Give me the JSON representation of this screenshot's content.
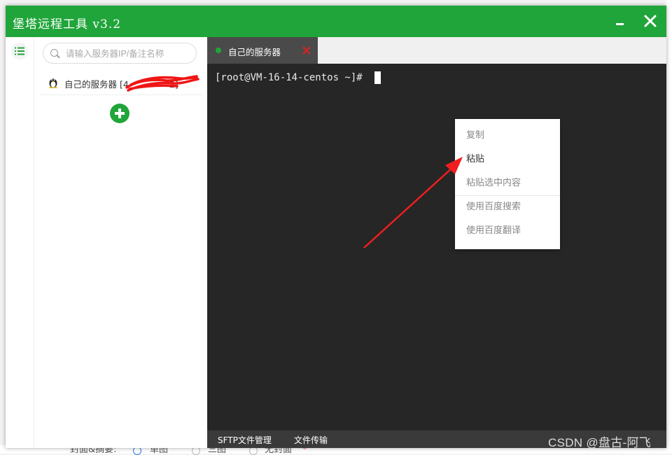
{
  "window": {
    "title": "堡塔远程工具 v3.2",
    "accent_color": "#20a53a"
  },
  "sidebar": {
    "search_placeholder": "请输入服务器IP/备注名称",
    "servers": [
      {
        "label": "自己的服务器 [4",
        "suffix": "2]",
        "os_icon": "linux-tux-icon"
      }
    ],
    "add_icon": "plus-icon"
  },
  "terminal": {
    "tabs": [
      {
        "label": "自己的服务器",
        "status_color": "#20a53a"
      }
    ],
    "prompt": "[root@VM-16-14-centos ~]#"
  },
  "bottom_bar": {
    "sftp_label": "SFTP文件管理",
    "transfer_label": "文件传输"
  },
  "context_menu": {
    "items": [
      {
        "label": "复制",
        "enabled": false
      },
      {
        "label": "粘贴",
        "enabled": true
      },
      {
        "label": "粘贴选中内容",
        "enabled": false
      },
      {
        "label": "使用百度搜索",
        "enabled": false
      },
      {
        "label": "使用百度翻译",
        "enabled": false
      }
    ]
  },
  "watermark": "CSDN @盘古-阿飞",
  "background_page": {
    "cover_label": "封面&摘要:",
    "option_single": "单图",
    "option_three": "三图",
    "option_none": "无封面",
    "required_mark": "*"
  }
}
